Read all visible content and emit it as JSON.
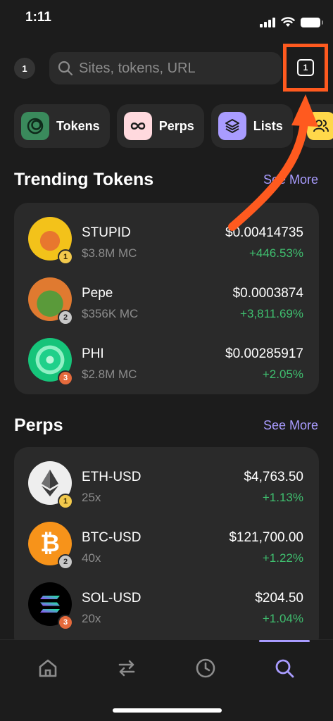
{
  "status": {
    "time": "1:11"
  },
  "search": {
    "tab_count": "1",
    "placeholder": "Sites, tokens, URL",
    "tabs_badge": "1"
  },
  "chips": [
    {
      "label": "Tokens",
      "icon": "tokens-icon",
      "color": "#3a8a5c"
    },
    {
      "label": "Perps",
      "icon": "infinity-icon",
      "color": "#ffd9de"
    },
    {
      "label": "Lists",
      "icon": "layers-icon",
      "color": "#a99cff"
    },
    {
      "label": "",
      "icon": "people-icon",
      "color": "#ffd84a"
    }
  ],
  "trending": {
    "title": "Trending Tokens",
    "see_more": "See More",
    "rows": [
      {
        "name": "STUPID",
        "sub": "$3.8M MC",
        "price": "$0.00414735",
        "change": "+446.53%",
        "rank": "1",
        "avatar_icon": "stupid-fox-icon"
      },
      {
        "name": "Pepe",
        "sub": "$356K MC",
        "price": "$0.0003874",
        "change": "+3,811.69%",
        "rank": "2",
        "avatar_icon": "pepe-frog-icon"
      },
      {
        "name": "PHI",
        "sub": "$2.8M MC",
        "price": "$0.00285917",
        "change": "+2.05%",
        "rank": "3",
        "avatar_icon": "phi-swirl-icon"
      }
    ]
  },
  "perps": {
    "title": "Perps",
    "see_more": "See More",
    "rows": [
      {
        "name": "ETH-USD",
        "sub": "25x",
        "price": "$4,763.50",
        "change": "+1.13%",
        "rank": "1",
        "avatar_icon": "ethereum-icon"
      },
      {
        "name": "BTC-USD",
        "sub": "40x",
        "price": "$121,700.00",
        "change": "+1.22%",
        "rank": "2",
        "avatar_icon": "bitcoin-icon"
      },
      {
        "name": "SOL-USD",
        "sub": "20x",
        "price": "$204.50",
        "change": "+1.04%",
        "rank": "3",
        "avatar_icon": "solana-icon"
      }
    ]
  },
  "nav": {
    "items": [
      {
        "icon": "home-icon",
        "active": false
      },
      {
        "icon": "swap-icon",
        "active": false
      },
      {
        "icon": "clock-icon",
        "active": false
      },
      {
        "icon": "search-icon",
        "active": true
      }
    ]
  },
  "colors": {
    "accent": "#a99cff",
    "positive": "#3fbf6f",
    "highlight": "#ff5a1f"
  }
}
